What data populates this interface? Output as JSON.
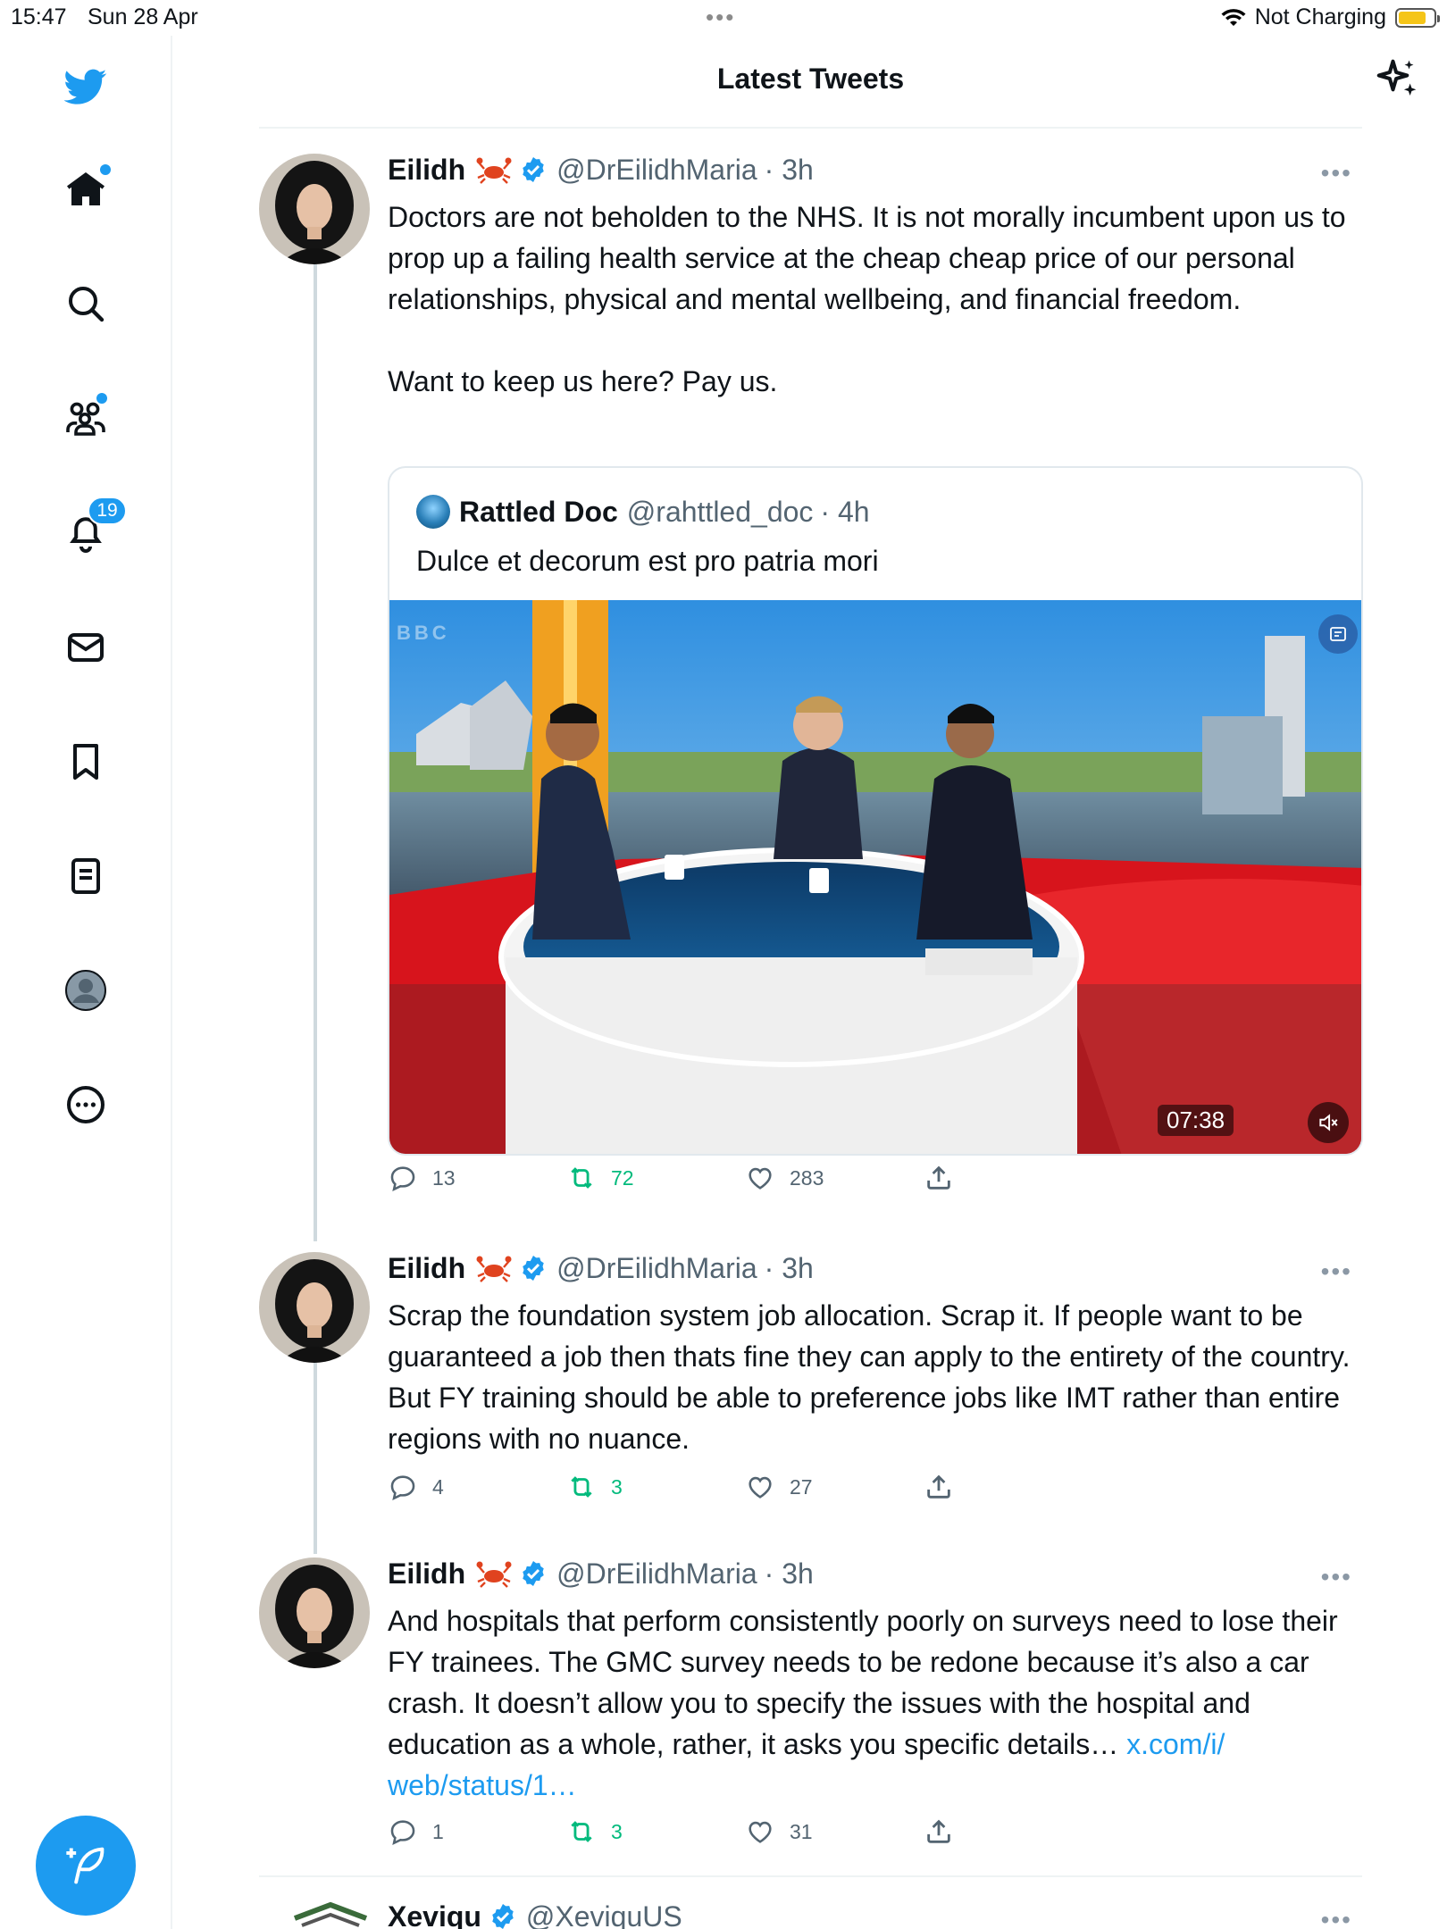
{
  "status_bar": {
    "time": "15:47",
    "date": "Sun 28 Apr",
    "battery_text": "Not Charging"
  },
  "header": {
    "title": "Latest Tweets"
  },
  "sidebar": {
    "items": [
      {
        "name": "home",
        "icon": "home-icon"
      },
      {
        "name": "explore",
        "icon": "search-icon"
      },
      {
        "name": "communities",
        "icon": "communities-icon"
      },
      {
        "name": "notifications",
        "icon": "bell-icon",
        "badge": "19"
      },
      {
        "name": "messages",
        "icon": "envelope-icon"
      },
      {
        "name": "bookmarks",
        "icon": "bookmark-icon"
      },
      {
        "name": "lists",
        "icon": "list-icon"
      },
      {
        "name": "profile",
        "icon": "avatar"
      },
      {
        "name": "more",
        "icon": "more-circle-icon"
      }
    ],
    "compose_icon": "compose-icon"
  },
  "tweets": [
    {
      "name": "Eilidh",
      "handle": "@DrEilidhMaria",
      "time": "· 3h",
      "text": "Doctors are not beholden to the NHS. It is not morally incumbent upon us to prop up a failing health service at the cheap cheap price of our personal relationships, physical and mental wellbeing, and financial freedom.\n\nWant to keep us here? Pay us.",
      "quote": {
        "name": "Rattled Doc",
        "handle": "@rahttled_doc",
        "time": "· 4h",
        "text": "Dulce et decorum est pro patria mori",
        "video_duration": "07:38",
        "watermark": "BBC"
      },
      "replies": "13",
      "retweets": "72",
      "likes": "283"
    },
    {
      "name": "Eilidh",
      "handle": "@DrEilidhMaria",
      "time": "· 3h",
      "text": "Scrap the foundation system job allocation. Scrap it. If people want to be guaranteed a job then thats fine they can apply to the entirety of the country. But FY training should be able to preference jobs like IMT rather than entire regions with no nuance.",
      "replies": "4",
      "retweets": "3",
      "likes": "27"
    },
    {
      "name": "Eilidh",
      "handle": "@DrEilidhMaria",
      "time": "· 3h",
      "text": "And hospitals that perform consistently poorly on surveys need to lose their FY trainees. The GMC survey needs to be redone because it’s also a car crash. It doesn’t allow you to specify the issues with the hospital and education as a whole, rather, it asks you specific details… ",
      "link": "x.com/i/\nweb/status/1…",
      "replies": "1",
      "retweets": "3",
      "likes": "31"
    },
    {
      "name": "Xeviqu",
      "handle": "@XeviquUS"
    }
  ],
  "colors": {
    "accent": "#1d9bf0",
    "retweet": "#00ba7c",
    "muted": "#536471",
    "divider": "#eff3f4"
  }
}
